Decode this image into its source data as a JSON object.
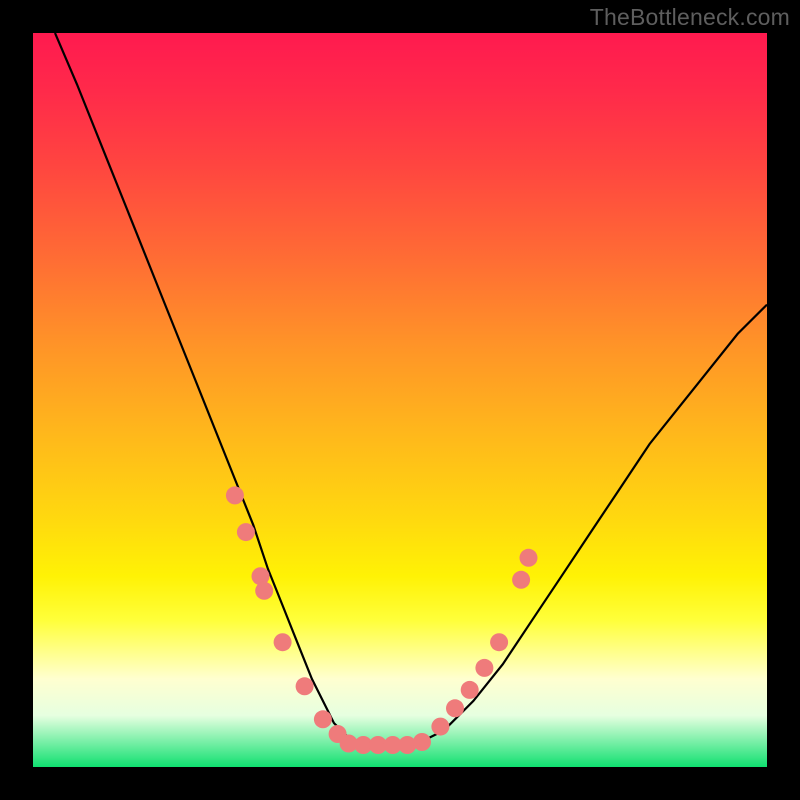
{
  "watermark": "TheBottleneck.com",
  "chart_data": {
    "type": "line",
    "title": "",
    "xlabel": "",
    "ylabel": "",
    "xlim": [
      0,
      100
    ],
    "ylim": [
      0,
      100
    ],
    "grid": false,
    "legend": false,
    "series": [
      {
        "name": "bottleneck-curve",
        "color": "#000000",
        "x": [
          3,
          6,
          10,
          14,
          18,
          22,
          26,
          28,
          30,
          32,
          34,
          36,
          38,
          40,
          41,
          43,
          45,
          48,
          52,
          56,
          60,
          64,
          68,
          72,
          76,
          80,
          84,
          88,
          92,
          96,
          100
        ],
        "y": [
          100,
          93,
          83,
          73,
          63,
          53,
          43,
          38,
          33,
          27,
          22,
          17,
          12,
          8,
          6,
          4,
          3,
          3,
          3,
          5,
          9,
          14,
          20,
          26,
          32,
          38,
          44,
          49,
          54,
          59,
          63
        ]
      }
    ],
    "markers": [
      {
        "name": "dots-left",
        "color": "#ef7b7b",
        "x": [
          27.5,
          29.0,
          31.0,
          31.5,
          34.0,
          37.0,
          39.5,
          41.5
        ],
        "y": [
          37.0,
          32.0,
          26.0,
          24.0,
          17.0,
          11.0,
          6.5,
          4.5
        ]
      },
      {
        "name": "dots-bottom",
        "color": "#ef7b7b",
        "x": [
          43.0,
          45.0,
          47.0,
          49.0,
          51.0,
          53.0
        ],
        "y": [
          3.2,
          3.0,
          3.0,
          3.0,
          3.0,
          3.4
        ]
      },
      {
        "name": "dots-right",
        "color": "#ef7b7b",
        "x": [
          55.5,
          57.5,
          59.5,
          61.5,
          63.5,
          66.5,
          67.5
        ],
        "y": [
          5.5,
          8.0,
          10.5,
          13.5,
          17.0,
          25.5,
          28.5
        ]
      }
    ],
    "annotations": []
  }
}
